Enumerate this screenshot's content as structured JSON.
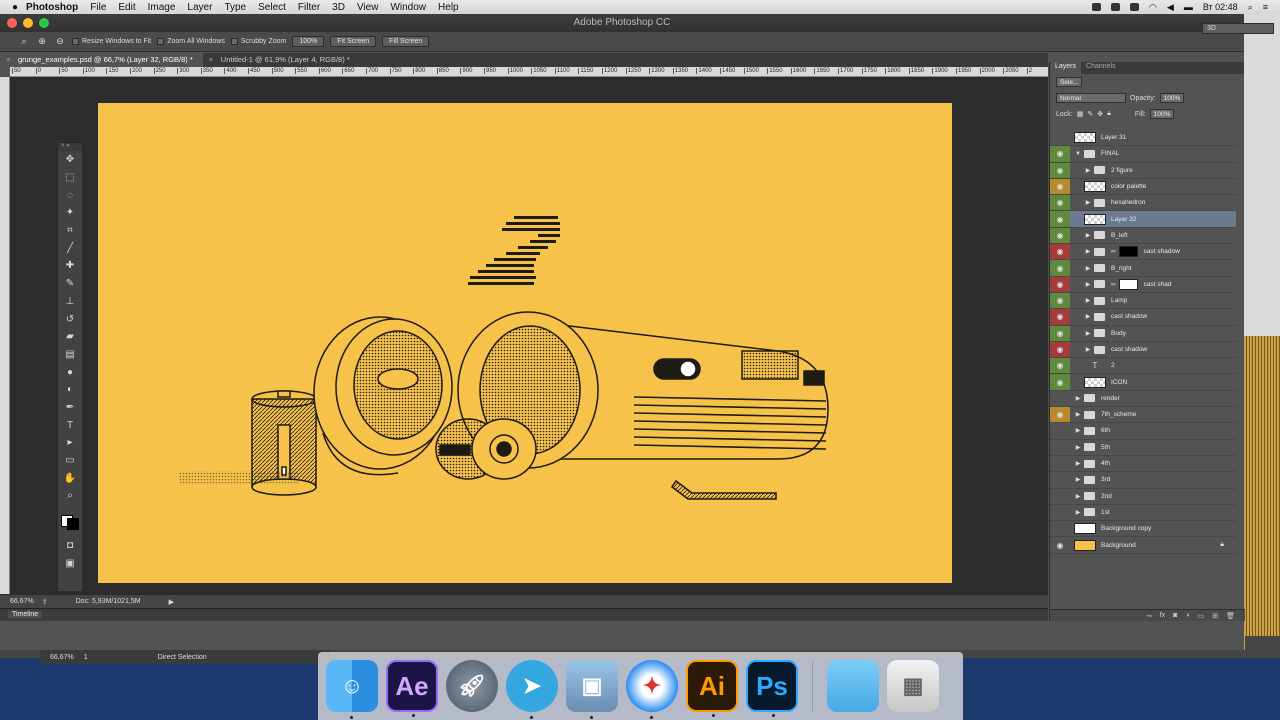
{
  "menubar": {
    "app_name": "Photoshop",
    "items": [
      "File",
      "Edit",
      "Image",
      "Layer",
      "Type",
      "Select",
      "Filter",
      "3D",
      "View",
      "Window",
      "Help"
    ],
    "clock": "Вт 02:48"
  },
  "window": {
    "title": "Adobe Photoshop CC"
  },
  "options_bar": {
    "resize_windows": "Resize Windows to Fit",
    "zoom_all": "Zoom All Windows",
    "scrubby": "Scrubby Zoom",
    "zoom_100": "100%",
    "fit_screen": "Fit Screen",
    "fill_screen": "Fill Screen",
    "workspace": "3D"
  },
  "tabs": [
    {
      "label": "grunge_examples.psd @ 66,7% (Layer 32, RGB/8) *"
    },
    {
      "label": "Untitled-1 @ 61,9% (Layer 4, RGB/8) *"
    }
  ],
  "ruler": {
    "ticks": [
      "50",
      "0",
      "50",
      "100",
      "150",
      "200",
      "250",
      "300",
      "350",
      "400",
      "450",
      "500",
      "550",
      "600",
      "650",
      "700",
      "750",
      "800",
      "850",
      "900",
      "950",
      "1000",
      "1050",
      "1100",
      "1150",
      "1200",
      "1250",
      "1300",
      "1350",
      "1400",
      "1450",
      "1500",
      "1550",
      "1600",
      "1650",
      "1700",
      "1750",
      "1800",
      "1850",
      "1900",
      "1950",
      "2000",
      "2050",
      "2"
    ]
  },
  "status": {
    "zoom": "66,67%",
    "doc": "Doc: 5,93M/1021,5M"
  },
  "timeline": {
    "label": "Timeline"
  },
  "colors": {
    "artboard": "#f6c24a",
    "ink": "#1e1a14",
    "eye_green": "#5f8a3d",
    "eye_red": "#a33c3a",
    "eye_yellow": "#b58b2b"
  },
  "layers_panel": {
    "tab_layers": "Layers",
    "tab_channels": "Channels",
    "filter_kind": "Sele...",
    "blend_mode": "Normal",
    "opacity_label": "Opacity:",
    "opacity_value": "100%",
    "lock_label": "Lock:",
    "fill_label": "Fill:",
    "fill_value": "100%",
    "layers": [
      {
        "name": "Layer 31",
        "kind": "pixel",
        "eye": "none",
        "indent": 0
      },
      {
        "name": "FINAL",
        "kind": "group-open",
        "eye": "green",
        "indent": 0
      },
      {
        "name": "2 figure",
        "kind": "group",
        "eye": "green",
        "indent": 1
      },
      {
        "name": "color palette",
        "kind": "pixel",
        "eye": "yellow",
        "indent": 1
      },
      {
        "name": "hexahedron",
        "kind": "group",
        "eye": "green",
        "indent": 1
      },
      {
        "name": "Layer 32",
        "kind": "pixel",
        "eye": "green",
        "indent": 1,
        "selected": true
      },
      {
        "name": "B_left",
        "kind": "group",
        "eye": "green",
        "indent": 1
      },
      {
        "name": "cast shadow",
        "kind": "group-mask-dark",
        "eye": "red",
        "indent": 1
      },
      {
        "name": "B_right",
        "kind": "group",
        "eye": "green",
        "indent": 1
      },
      {
        "name": "cast shad",
        "kind": "group-mask-light",
        "eye": "red",
        "indent": 1
      },
      {
        "name": "Lamp",
        "kind": "group",
        "eye": "green",
        "indent": 1
      },
      {
        "name": "cast shadow",
        "kind": "group",
        "eye": "red",
        "indent": 1
      },
      {
        "name": "Body",
        "kind": "group",
        "eye": "green",
        "indent": 1
      },
      {
        "name": "cast shadow",
        "kind": "group",
        "eye": "red",
        "indent": 1
      },
      {
        "name": "2",
        "kind": "text",
        "eye": "green",
        "indent": 1
      },
      {
        "name": "ICON",
        "kind": "smart",
        "eye": "green",
        "indent": 1
      },
      {
        "name": "render",
        "kind": "group",
        "eye": "none",
        "indent": 0
      },
      {
        "name": "7th_scheme",
        "kind": "group",
        "eye": "yellow",
        "indent": 0
      },
      {
        "name": "6th",
        "kind": "group",
        "eye": "none",
        "indent": 0
      },
      {
        "name": "5th",
        "kind": "group",
        "eye": "none",
        "indent": 0
      },
      {
        "name": "4th",
        "kind": "group",
        "eye": "none",
        "indent": 0
      },
      {
        "name": "3rd",
        "kind": "group",
        "eye": "none",
        "indent": 0
      },
      {
        "name": "2nd",
        "kind": "group",
        "eye": "none",
        "indent": 0
      },
      {
        "name": "1st",
        "kind": "group",
        "eye": "none",
        "indent": 0
      },
      {
        "name": "Background copy",
        "kind": "white",
        "eye": "none",
        "indent": 0
      },
      {
        "name": "Background",
        "kind": "yellow",
        "eye": "visible",
        "indent": 0,
        "locked": true
      }
    ]
  },
  "tools": [
    "move-tool",
    "marquee-tool",
    "lasso-tool",
    "quick-select-tool",
    "crop-tool",
    "eyedropper-tool",
    "healing-tool",
    "brush-tool",
    "stamp-tool",
    "history-brush-tool",
    "eraser-tool",
    "gradient-tool",
    "blur-tool",
    "dodge-tool",
    "pen-tool",
    "type-tool",
    "path-select-tool",
    "rectangle-tool",
    "hand-tool",
    "zoom-tool"
  ],
  "bg_window": {
    "zoom": "66,67%",
    "page": "1",
    "status": "Direct Selection"
  },
  "dock": [
    {
      "name": "finder-icon",
      "running": true
    },
    {
      "name": "after-effects-icon",
      "label": "Ae",
      "running": true
    },
    {
      "name": "launchpad-icon",
      "running": false
    },
    {
      "name": "telegram-icon",
      "running": true
    },
    {
      "name": "preview-icon",
      "running": true
    },
    {
      "name": "safari-icon",
      "running": true
    },
    {
      "name": "illustrator-icon",
      "label": "Ai",
      "running": true
    },
    {
      "name": "photoshop-icon",
      "label": "Ps",
      "running": true
    },
    {
      "name": "downloads-folder-icon",
      "running": false
    },
    {
      "name": "trash-icon",
      "running": false
    }
  ]
}
